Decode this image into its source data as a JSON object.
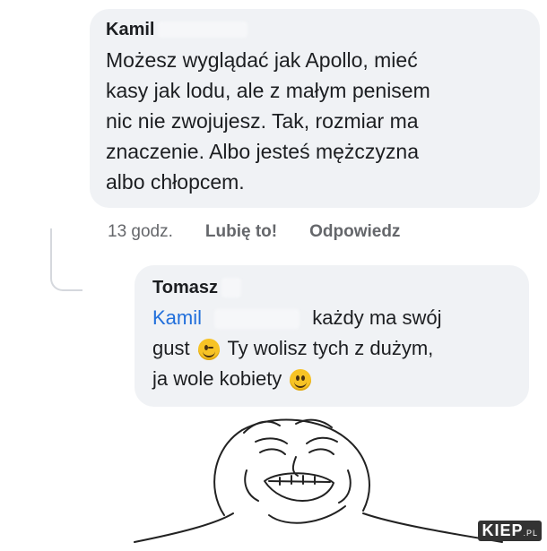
{
  "comment": {
    "author": "Kamil",
    "text_lines": [
      "Możesz wyglądać jak Apollo, mieć",
      "kasy jak lodu, ale z małym penisem",
      "nic nie zwojujesz. Tak, rozmiar ma",
      "znaczenie. Albo jesteś mężczyzna",
      "albo chłopcem."
    ],
    "time": "13 godz.",
    "like_label": "Lubię to!",
    "reply_label": "Odpowiedz"
  },
  "reply": {
    "author": "Tomasz",
    "mention": "Kamil",
    "line1_rest": "każdy ma swój",
    "line2_start": "gust",
    "line2_rest": "Ty wolisz tych z dużym,",
    "line3": "ja wole kobiety"
  },
  "emojis": [
    "winking-face",
    "smiling-face"
  ],
  "watermark": {
    "brand": "KIEP",
    "suffix": ".PL"
  },
  "colors": {
    "bubble": "#f0f2f5",
    "mention": "#216fdb",
    "meta": "#65676b"
  }
}
